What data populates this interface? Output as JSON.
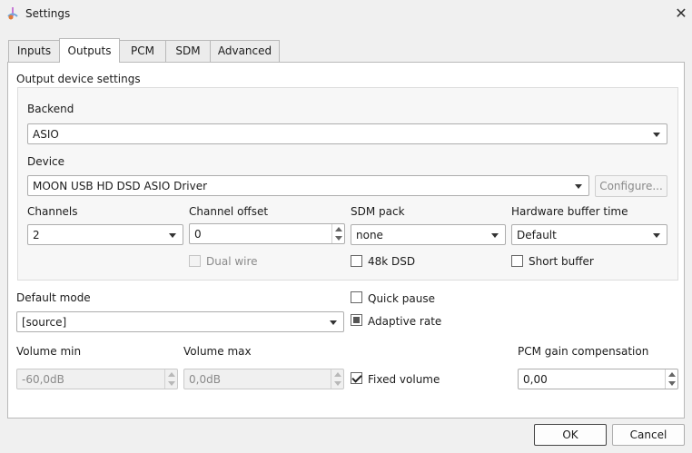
{
  "window": {
    "title": "Settings",
    "app_icon": "note-icon",
    "close_glyph": "✕"
  },
  "tabs": [
    {
      "label": "Inputs"
    },
    {
      "label": "Outputs",
      "active": true
    },
    {
      "label": "PCM"
    },
    {
      "label": "SDM"
    },
    {
      "label": "Advanced"
    }
  ],
  "output_device": {
    "group_title": "Output device settings",
    "backend": {
      "label": "Backend",
      "value": "ASIO"
    },
    "device": {
      "label": "Device",
      "value": "MOON USB HD DSD ASIO Driver",
      "configure_label": "Configure..."
    },
    "channels": {
      "label": "Channels",
      "value": "2"
    },
    "channel_offset": {
      "label": "Channel offset",
      "value": "0"
    },
    "sdm_pack": {
      "label": "SDM pack",
      "value": "none"
    },
    "hardware_buffer_time": {
      "label": "Hardware buffer time",
      "value": "Default"
    },
    "dual_wire": {
      "label": "Dual wire",
      "checked": false,
      "disabled": true
    },
    "dsd_48k": {
      "label": "48k DSD",
      "checked": false
    },
    "short_buffer": {
      "label": "Short buffer",
      "checked": false
    }
  },
  "default_mode": {
    "label": "Default mode",
    "value": "[source]"
  },
  "quick_pause": {
    "label": "Quick pause",
    "checked": false
  },
  "adaptive_rate": {
    "label": "Adaptive rate",
    "state": "partial"
  },
  "volume_min": {
    "label": "Volume min",
    "value": "-60,0dB"
  },
  "volume_max": {
    "label": "Volume max",
    "value": "0,0dB"
  },
  "fixed_volume": {
    "label": "Fixed volume",
    "checked": true
  },
  "pcm_gain": {
    "label": "PCM gain compensation",
    "value": "0,00"
  },
  "footer": {
    "ok_label": "OK",
    "cancel_label": "Cancel"
  }
}
